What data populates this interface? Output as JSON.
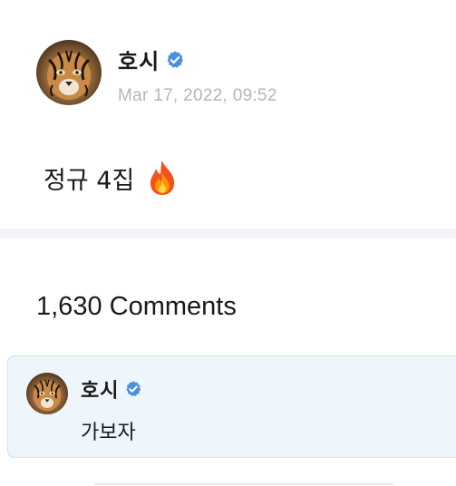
{
  "post": {
    "author": "호시",
    "verified": true,
    "timestamp": "Mar 17, 2022, 09:52",
    "text": "정규 4집",
    "emoji_icon": "fire-icon",
    "avatar_icon": "tiger-avatar"
  },
  "comments": {
    "count_label": "1,630 Comments",
    "items": [
      {
        "author": "호시",
        "verified": true,
        "text": "가보자",
        "avatar_icon": "tiger-avatar"
      }
    ]
  },
  "colors": {
    "verified_blue": "#4a90e2",
    "timestamp_gray": "#b3b6bb",
    "comment_bg": "#eef6fc",
    "comment_border": "#cfe3f1",
    "divider_bg": "#f2f3f6"
  }
}
